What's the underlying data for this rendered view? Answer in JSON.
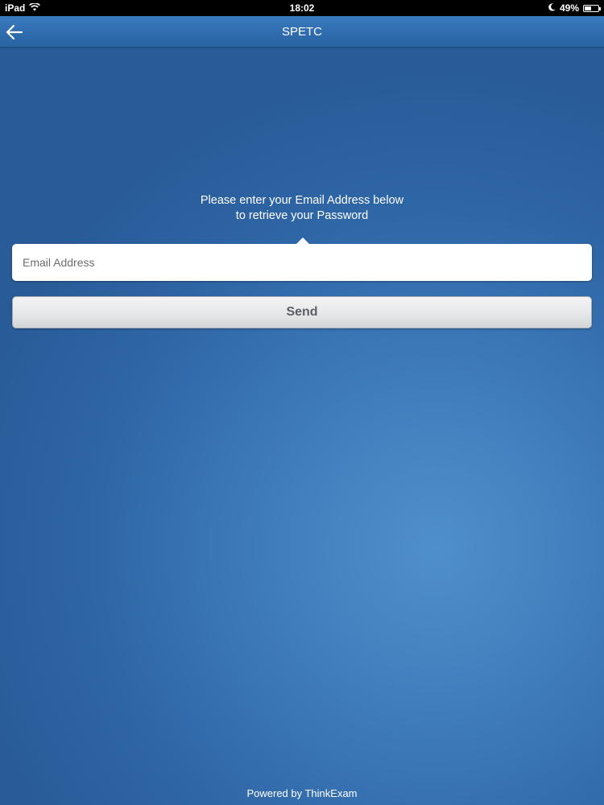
{
  "status_bar": {
    "device": "iPad",
    "time": "18:02",
    "battery_percent_text": "49%",
    "battery_level": 0.49,
    "icons": [
      "wifi-icon",
      "moon-icon",
      "battery-icon"
    ]
  },
  "nav": {
    "title": "SPETC",
    "back_icon": "back-arrow-icon"
  },
  "instruction": {
    "line1": "Please enter your Email Address below",
    "line2": "to retrieve your Password"
  },
  "email": {
    "placeholder": "Email Address",
    "value": ""
  },
  "send": {
    "label": "Send"
  },
  "footer": {
    "text": "Powered by ThinkExam"
  },
  "colors": {
    "background": "#3f7cbb",
    "nav_bar": "#2e6bad",
    "button_text": "#5b5f66"
  }
}
